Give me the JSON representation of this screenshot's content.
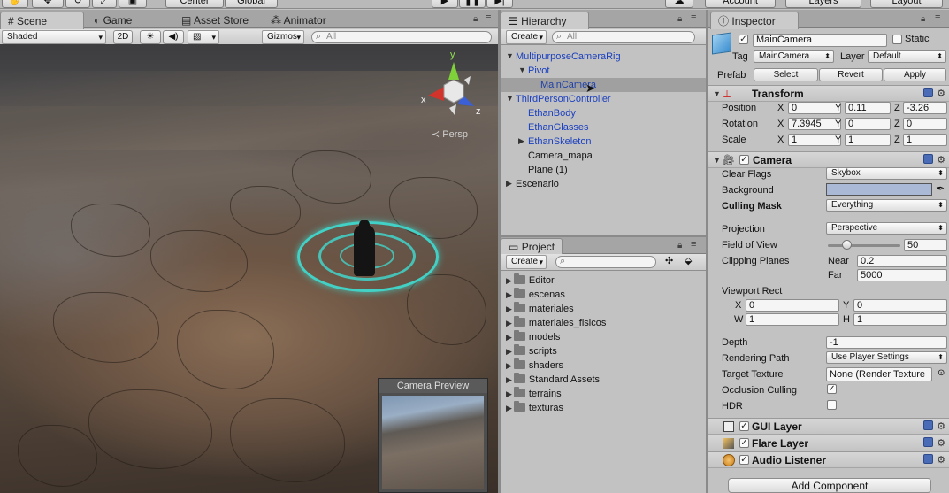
{
  "top_toolbar": {
    "pivot_center_label": "Center",
    "pivot_space_label": "Global",
    "account_label": "Account",
    "layers_label": "Layers",
    "layout_label": "Layout"
  },
  "scene_tabs": [
    {
      "label": "Scene",
      "icon": "scene-icon"
    },
    {
      "label": "Game",
      "icon": "game-icon"
    },
    {
      "label": "Asset Store",
      "icon": "store-icon"
    },
    {
      "label": "Animator",
      "icon": "animator-icon"
    }
  ],
  "scene_toolbar": {
    "shading_mode": "Shaded",
    "mode_2d": "2D",
    "gizmos_label": "Gizmos",
    "search_placeholder": "All"
  },
  "scene_view": {
    "projection_label": "Persp",
    "gizmo_axes": {
      "x": "x",
      "y": "y",
      "z": "z"
    },
    "camera_preview_title": "Camera Preview"
  },
  "hierarchy": {
    "tab_label": "Hierarchy",
    "create_label": "Create",
    "search_placeholder": "All",
    "items": [
      {
        "label": "MultipurposeCameraRig",
        "blue": true,
        "expanded": true
      },
      {
        "label": "Pivot",
        "blue": true,
        "expanded": true
      },
      {
        "label": "MainCamera",
        "blue": true,
        "selected": true
      },
      {
        "label": "ThirdPersonController",
        "blue": true,
        "expanded": true
      },
      {
        "label": "EthanBody",
        "blue": true
      },
      {
        "label": "EthanGlasses",
        "blue": true
      },
      {
        "label": "EthanSkeleton",
        "blue": true,
        "expanded": false
      },
      {
        "label": "Camera_mapa",
        "blue": false
      },
      {
        "label": "Plane (1)",
        "blue": false
      },
      {
        "label": "Escenario",
        "blue": false,
        "expanded": false
      }
    ]
  },
  "project": {
    "tab_label": "Project",
    "create_label": "Create",
    "folders": [
      "Editor",
      "escenas",
      "materiales",
      "materiales_fisicos",
      "models",
      "scripts",
      "shaders",
      "Standard Assets",
      "terrains",
      "texturas"
    ]
  },
  "inspector": {
    "tab_label": "Inspector",
    "object_name": "MainCamera",
    "static_label": "Static",
    "tag_label": "Tag",
    "tag_value": "MainCamera",
    "layer_label": "Layer",
    "layer_value": "Default",
    "prefab_label": "Prefab",
    "prefab_select": "Select",
    "prefab_revert": "Revert",
    "prefab_apply": "Apply",
    "transform": {
      "title": "Transform",
      "position_label": "Position",
      "rotation_label": "Rotation",
      "scale_label": "Scale",
      "axis_x": "X",
      "axis_y": "Y",
      "axis_z": "Z",
      "position": {
        "x": "0",
        "y": "0.11",
        "z": "-3.26"
      },
      "rotation": {
        "x": "7.3945",
        "y": "0",
        "z": "0"
      },
      "scale": {
        "x": "1",
        "y": "1",
        "z": "1"
      }
    },
    "camera": {
      "title": "Camera",
      "clear_flags_label": "Clear Flags",
      "clear_flags_value": "Skybox",
      "background_label": "Background",
      "background_color": "#a9b9d6",
      "culling_mask_label": "Culling Mask",
      "culling_mask_value": "Everything",
      "projection_label": "Projection",
      "projection_value": "Perspective",
      "fov_label": "Field of View",
      "fov_value": "50",
      "fov_slider_fraction": 0.27,
      "clipping_label": "Clipping Planes",
      "near_label": "Near",
      "near_value": "0.2",
      "far_label": "Far",
      "far_value": "5000",
      "viewport_label": "Viewport Rect",
      "vp_x_label": "X",
      "vp_x": "0",
      "vp_y_label": "Y",
      "vp_y": "0",
      "vp_w_label": "W",
      "vp_w": "1",
      "vp_h_label": "H",
      "vp_h": "1",
      "depth_label": "Depth",
      "depth_value": "-1",
      "rendering_path_label": "Rendering Path",
      "rendering_path_value": "Use Player Settings",
      "target_texture_label": "Target Texture",
      "target_texture_value": "None (Render Texture",
      "occlusion_label": "Occlusion Culling",
      "occlusion_checked": true,
      "hdr_label": "HDR",
      "hdr_checked": false
    },
    "components": [
      {
        "title": "GUI Layer",
        "icon": "gui-layer-icon"
      },
      {
        "title": "Flare Layer",
        "icon": "flare-layer-icon"
      },
      {
        "title": "Audio Listener",
        "icon": "audio-listener-icon"
      }
    ],
    "add_component_label": "Add Component"
  }
}
